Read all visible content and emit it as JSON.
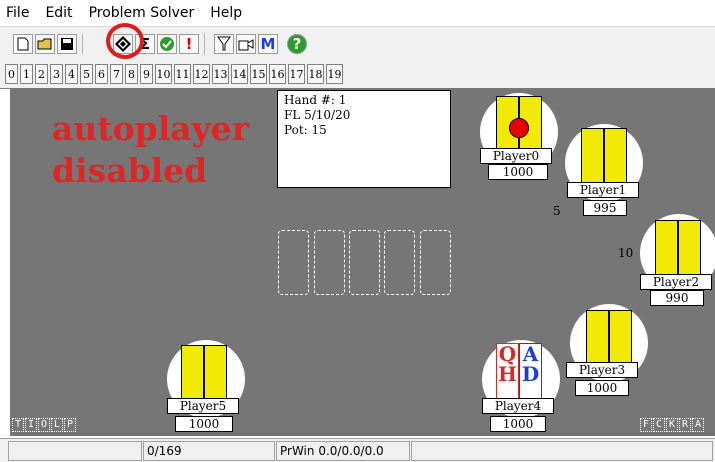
{
  "menu": [
    "File",
    "Edit",
    "Problem Solver",
    "Help"
  ],
  "toolbar": {
    "new_icon": "new-document-icon",
    "open_icon": "open-folder-icon",
    "save_icon": "save-disk-icon",
    "autoplayer_icon": "autoplayer-diamond-icon",
    "sum_label": "Σ",
    "check_icon": "green-check-icon",
    "alert_label": "!",
    "filter_icon": "filter-funnel-icon",
    "hand_icon": "hand-icon",
    "m_label": "M",
    "help_label": "?"
  },
  "seat_numbers": [
    "0",
    "1",
    "2",
    "3",
    "4",
    "5",
    "6",
    "7",
    "8",
    "9",
    "10",
    "11",
    "12",
    "13",
    "14",
    "15",
    "16",
    "17",
    "18",
    "19"
  ],
  "hand_info": {
    "hand": "Hand #: 1",
    "limit": "FL 5/10/20",
    "pot": "Pot: 15"
  },
  "notice": {
    "line1": "autoplayer",
    "line2": "disabled"
  },
  "players": [
    {
      "name": "Player0",
      "stack": "1000",
      "bet": ""
    },
    {
      "name": "Player1",
      "stack": "995",
      "bet": "5"
    },
    {
      "name": "Player2",
      "stack": "990",
      "bet": "10"
    },
    {
      "name": "Player3",
      "stack": "1000",
      "bet": ""
    },
    {
      "name": "Player4",
      "stack": "1000",
      "bet": ""
    },
    {
      "name": "Player5",
      "stack": "1000",
      "bet": ""
    }
  ],
  "player4_cards": {
    "card1_rank": "Q",
    "card1_suit": "H",
    "card2_rank": "A",
    "card2_suit": "D"
  },
  "left_buttons": [
    "T",
    "I",
    "O",
    "L",
    "P"
  ],
  "right_buttons": [
    "F",
    "C",
    "K",
    "R",
    "A"
  ],
  "status": {
    "progress": "0/169",
    "prwin": "PrWin 0.0/0.0/0.0"
  },
  "colors": {
    "table": "#767676",
    "card_back": "#f2ea00",
    "notice": "#e02525",
    "highlight": "#e01b1b"
  }
}
